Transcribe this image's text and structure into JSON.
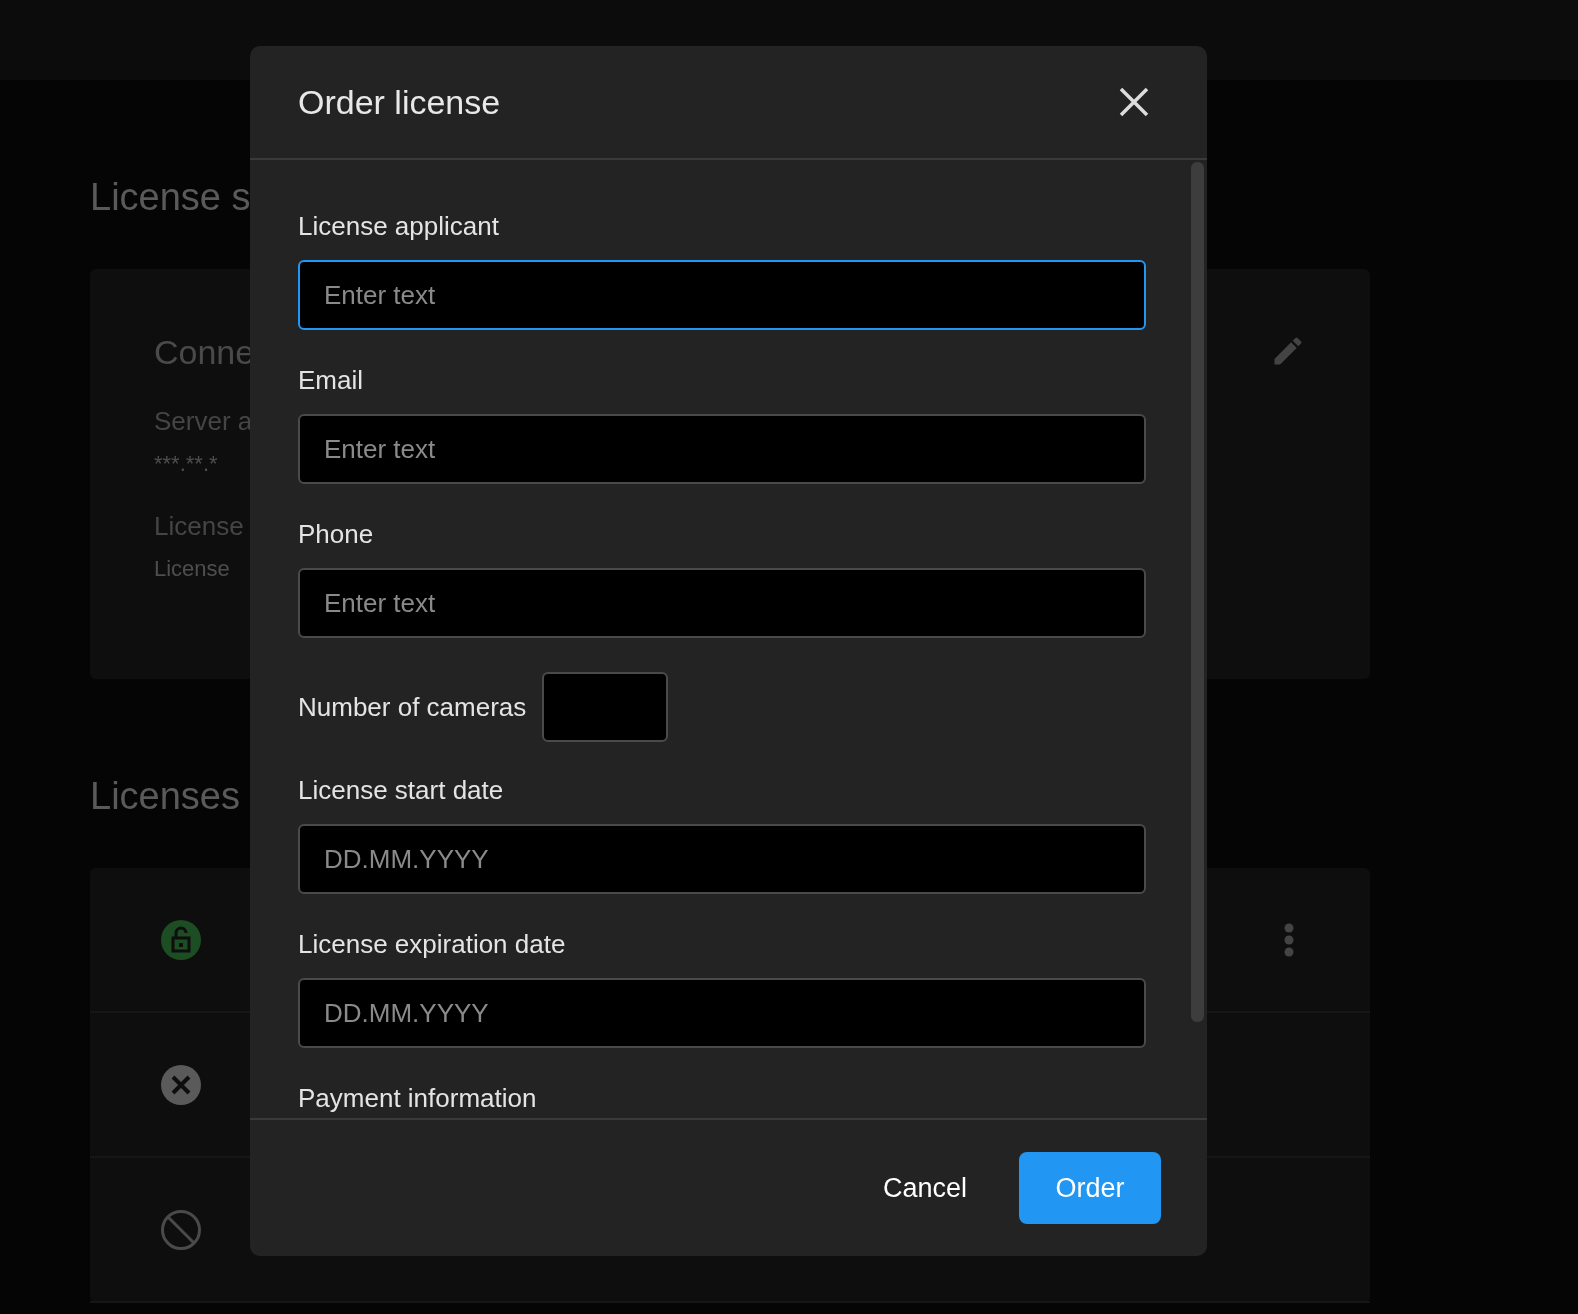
{
  "page": {
    "heading": "License s",
    "connection_card": {
      "title": "Conne",
      "fields": [
        {
          "label": "Server a",
          "value": "***.**.*"
        },
        {
          "label": "License",
          "value": "License"
        }
      ]
    },
    "licenses_heading": "Licenses",
    "license_rows": [
      {
        "kind": "active",
        "menu_shown": true
      },
      {
        "kind": "error",
        "menu_shown": false
      },
      {
        "kind": "blocked",
        "menu_shown": false
      }
    ]
  },
  "dialog": {
    "title": "Order license",
    "fields": [
      {
        "kind": "text",
        "label": "License applicant",
        "placeholder": "Enter text",
        "focused": true
      },
      {
        "kind": "text",
        "label": "Email",
        "placeholder": "Enter text",
        "focused": false
      },
      {
        "kind": "text",
        "label": "Phone",
        "placeholder": "Enter text",
        "focused": false
      },
      {
        "kind": "number",
        "label": "Number of cameras",
        "focused": false
      },
      {
        "kind": "text",
        "label": "License start date",
        "placeholder": "DD.MM.YYYY",
        "focused": false
      },
      {
        "kind": "text",
        "label": "License expiration date",
        "placeholder": "DD.MM.YYYY",
        "focused": false
      },
      {
        "kind": "heading",
        "label": "Payment information"
      }
    ],
    "buttons": [
      {
        "kind": "text",
        "label": "Cancel"
      },
      {
        "kind": "primary",
        "label": "Order"
      }
    ]
  }
}
